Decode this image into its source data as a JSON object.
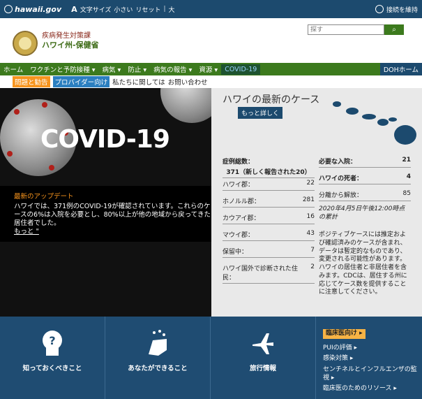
{
  "topbar": {
    "gov": "hawaii.gov",
    "text_size_label": "文字サイズ",
    "small": "小さい",
    "reset": "リセット",
    "large": "大",
    "stay_connected": "接続を維持"
  },
  "header": {
    "dept_line1": "疾病発生対策課",
    "dept_line2": "ハワイ州-保健省",
    "search_placeholder": "探す"
  },
  "nav": {
    "items": [
      "ホーム",
      "ワクチンと予防接種 ▾",
      "病気 ▾",
      "防止 ▾",
      "病気の報告 ▾",
      "資源 ▾"
    ],
    "covid": "COVID-19",
    "doh": "DOHホーム"
  },
  "subnav": {
    "questions": "問題と勧告",
    "providers": "プロバイダー向け",
    "about": "私たちに関しては",
    "contact": "お問い合わせ"
  },
  "hero": {
    "title": "COVID-19"
  },
  "update": {
    "heading": "最新のアップデート",
    "body": "ハワイでは、371例のCOVID-19が確認されています。これらのケースの6%は入院を必要とし、80%以上が他の地域から戻ってきた居住者でした。",
    "more": "もっと \""
  },
  "cases": {
    "heading": "ハワイの最新のケース",
    "more": "もっと詳しく",
    "total_label": "症例総数：",
    "total_value": "371（新しく報告された20）",
    "left": [
      {
        "label": "ハワイ郡：",
        "value": "22"
      },
      {
        "label": "ホノルル郡：",
        "value": "281"
      },
      {
        "label": "カウアイ郡：",
        "value": "16"
      },
      {
        "label": "マウイ郡：",
        "value": "43"
      },
      {
        "label": "保留中：",
        "value": "7"
      },
      {
        "label": "ハワイ国外で診断された住民：",
        "value": "2"
      }
    ],
    "right": [
      {
        "label": "必要な入院：",
        "value": "21"
      },
      {
        "label": "ハワイの死者：",
        "value": "4"
      },
      {
        "label": "分離から解放：",
        "value": "85"
      }
    ],
    "asof": "2020年4月5日午後12:00時点の累計",
    "note": "ポジティブケースには推定および確認済みのケースが含まれ、データは暫定的なものであり、変更される可能性があります。ハワイの居住者と非居住者を含みます。CDCは、居住する州に応じてケース数を提供することに注意してください。"
  },
  "tiles": {
    "know": "知っておくべきこと",
    "can_do": "あなたができること",
    "travel": "旅行情報"
  },
  "clinicians": {
    "badge": "臨床医向け ▸",
    "links": [
      "PUIの評価",
      "感染対策",
      "センチネルとインフルエンザの監視",
      "臨床医のためのリソース"
    ]
  },
  "colors": {
    "nav_green": "#3c7a1d",
    "top_blue": "#1c4a6e",
    "accent_orange": "#f7941d"
  }
}
